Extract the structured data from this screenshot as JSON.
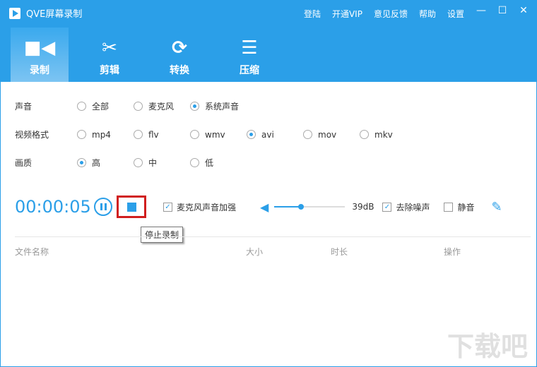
{
  "app": {
    "title": "QVE屏幕录制"
  },
  "menu": [
    "登陆",
    "开通VIP",
    "意见反馈",
    "帮助",
    "设置"
  ],
  "tabs": [
    {
      "label": "录制"
    },
    {
      "label": "剪辑"
    },
    {
      "label": "转换"
    },
    {
      "label": "压缩"
    }
  ],
  "sound": {
    "label": "声音",
    "options": [
      "全部",
      "麦克风",
      "系统声音"
    ],
    "selected": 2
  },
  "format": {
    "label": "视频格式",
    "options": [
      "mp4",
      "flv",
      "wmv",
      "avi",
      "mov",
      "mkv"
    ],
    "selected": 3
  },
  "quality": {
    "label": "画质",
    "options": [
      "高",
      "中",
      "低"
    ],
    "selected": 0
  },
  "controls": {
    "time": "00:00:05",
    "mic_boost": "麦克风声音加强",
    "volume_db": "39dB",
    "volume_level": 0.38,
    "denoise": "去除噪声",
    "mute": "静音",
    "tooltip": "停止录制"
  },
  "table": {
    "headers": [
      "文件名称",
      "大小",
      "时长",
      "操作"
    ]
  },
  "watermark": "下载吧"
}
